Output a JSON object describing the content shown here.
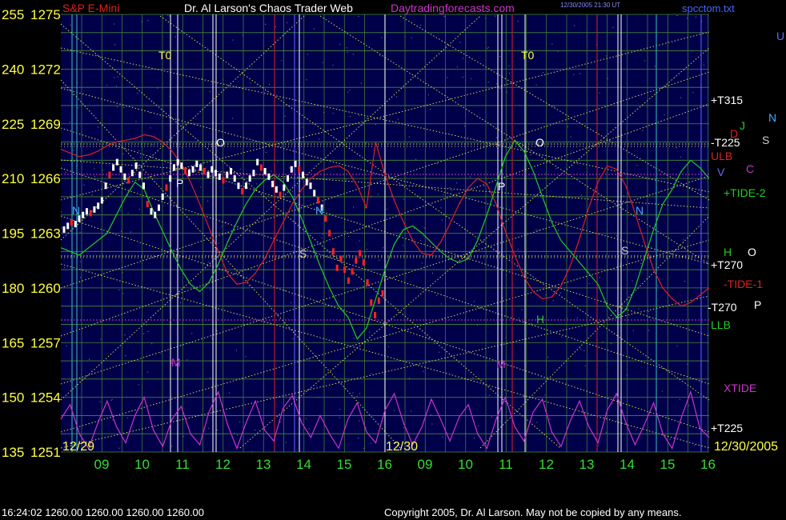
{
  "header": {
    "instrument": "S&P E-Mini",
    "author": "Dr. Al Larson's Chaos Trader Web",
    "site": "Daytradingforecasts.com",
    "stamp_line1": "12/30/2005 21:30 UT",
    "file": "spcctom.txt"
  },
  "footer": {
    "status": "16:24:02  1260.00  1260.00  1260.00  1260.00",
    "copyright": "Copyright 2005, Dr. Al Larson. May not be copied by any means."
  },
  "colors": {
    "background": "#00004a",
    "grid": "#4a8a38",
    "price": "#ffffff",
    "price_alt": "#ff2020",
    "tide": "#22cc22",
    "ulb": "#dd2020",
    "xtide": "#cc33cc",
    "fan": "#e8e850",
    "axis_text": "#ffff44",
    "time_text": "#33dd33"
  },
  "chart_data": {
    "type": "line",
    "title": "",
    "y_left_outer": {
      "ticks": [
        255,
        240,
        225,
        210,
        195,
        180,
        165,
        150,
        135
      ]
    },
    "y_left_inner": {
      "ticks": [
        1275,
        1272,
        1269,
        1266,
        1263,
        1260,
        1257,
        1254,
        1251
      ],
      "ylim": [
        1251,
        1275
      ]
    },
    "x_ticks": [
      "09",
      "10",
      "11",
      "12",
      "13",
      "14",
      "15",
      "16",
      "09",
      "10",
      "11",
      "12",
      "13",
      "14",
      "15",
      "16"
    ],
    "date_labels": [
      "12/29",
      "12/30",
      "12/30/2005"
    ],
    "right_labels": [
      {
        "text": "+T315",
        "color": "#ffffff"
      },
      {
        "text": "J",
        "color": "#22cc22"
      },
      {
        "text": "N",
        "color": "#44aaff"
      },
      {
        "text": "D",
        "color": "#dd2020"
      },
      {
        "text": "-T225",
        "color": "#ffffff"
      },
      {
        "text": "S",
        "color": "#cccccc"
      },
      {
        "text": "ULB",
        "color": "#dd2020"
      },
      {
        "text": "V",
        "color": "#6666ff"
      },
      {
        "text": "C",
        "color": "#cc33cc"
      },
      {
        "text": "+TIDE-2",
        "color": "#22cc22"
      },
      {
        "text": "H",
        "color": "#22cc22"
      },
      {
        "text": "O",
        "color": "#ffffff"
      },
      {
        "text": "+T270",
        "color": "#ffffff"
      },
      {
        "text": "-TIDE-1",
        "color": "#dd2020"
      },
      {
        "text": "-T270",
        "color": "#ffffff"
      },
      {
        "text": "P",
        "color": "#ffffff"
      },
      {
        "text": "LLB",
        "color": "#22cc22"
      },
      {
        "text": "XTIDE",
        "color": "#cc33cc"
      },
      {
        "text": "+T225",
        "color": "#ffffff"
      },
      {
        "text": "U",
        "color": "#6666ff"
      }
    ],
    "markers": [
      "T0",
      "T0",
      "O",
      "O",
      "P",
      "P",
      "N",
      "N",
      "N",
      "S",
      "S",
      "M",
      "M",
      "H"
    ],
    "price_1m": [
      1263.2,
      1263.4,
      1263.6,
      1263.5,
      1263.8,
      1264.0,
      1264.2,
      1264.1,
      1264.3,
      1264.5,
      1264.8,
      1265.6,
      1266.2,
      1266.6,
      1266.9,
      1266.5,
      1266.1,
      1265.9,
      1266.3,
      1266.7,
      1266.2,
      1265.6,
      1264.6,
      1264.2,
      1264.0,
      1264.4,
      1265.0,
      1265.5,
      1266.0,
      1266.6,
      1266.9,
      1266.7,
      1266.4,
      1266.3,
      1266.5,
      1266.8,
      1266.6,
      1266.4,
      1266.2,
      1266.5,
      1266.3,
      1266.1,
      1265.9,
      1266.2,
      1266.4,
      1266.0,
      1265.6,
      1265.3,
      1265.6,
      1266.0,
      1266.3,
      1266.9,
      1266.6,
      1266.4,
      1266.1,
      1265.7,
      1265.4,
      1265.1,
      1265.5,
      1266.0,
      1266.5,
      1266.8,
      1266.5,
      1266.2,
      1265.8,
      1265.6,
      1265.2,
      1264.8,
      1264.4,
      1263.8,
      1263.0,
      1262.0,
      1261.1,
      1261.6,
      1261.0,
      1260.4,
      1260.9,
      1261.5,
      1261.9,
      1261.4,
      1260.3,
      1259.2,
      1258.5,
      1259.3,
      1259.7
    ],
    "tide": [
      1262.2,
      1262.0,
      1261.8,
      1262.2,
      1262.6,
      1263.0,
      1264.0,
      1265.0,
      1265.8,
      1265.4,
      1264.2,
      1263.1,
      1262.0,
      1261.0,
      1260.2,
      1259.8,
      1260.3,
      1261.3,
      1262.5,
      1263.6,
      1264.6,
      1265.4,
      1265.9,
      1266.2,
      1265.8,
      1265.0,
      1263.8,
      1262.5,
      1261.2,
      1260.0,
      1259.0,
      1258.4,
      1257.2,
      1257.8,
      1259.4,
      1261.0,
      1262.4,
      1263.2,
      1263.4,
      1263.0,
      1262.5,
      1262.0,
      1261.6,
      1261.4,
      1261.6,
      1262.6,
      1264.0,
      1265.6,
      1267.2,
      1268.1,
      1267.5,
      1266.4,
      1265.0,
      1263.6,
      1262.6,
      1262.0,
      1261.4,
      1260.8,
      1260.2,
      1259.0,
      1258.4,
      1258.8,
      1260.0,
      1261.6,
      1263.2,
      1264.6,
      1265.4,
      1266.4,
      1267.0,
      1266.6,
      1266.0
    ],
    "ulb": [
      1267.6,
      1267.4,
      1267.2,
      1267.3,
      1267.5,
      1267.8,
      1268.0,
      1268.1,
      1268.2,
      1268.4,
      1268.3,
      1268.0,
      1267.5,
      1266.8,
      1265.8,
      1264.6,
      1263.3,
      1262.0,
      1260.8,
      1260.2,
      1260.3,
      1260.8,
      1261.6,
      1262.6,
      1263.6,
      1264.6,
      1265.4,
      1266.0,
      1266.4,
      1266.6,
      1266.7,
      1266.4,
      1265.6,
      1264.4,
      1268.0,
      1266.2,
      1264.8,
      1263.6,
      1262.6,
      1261.9,
      1261.8,
      1262.5,
      1263.5,
      1264.6,
      1265.5,
      1266.0,
      1265.7,
      1264.6,
      1263.1,
      1261.8,
      1260.6,
      1259.8,
      1259.4,
      1259.5,
      1260.1,
      1261.2,
      1262.7,
      1264.4,
      1265.8,
      1266.7,
      1266.5,
      1265.6,
      1264.1,
      1262.5,
      1261.0,
      1260.0,
      1259.4,
      1259.0,
      1259.2,
      1259.6,
      1260.0
    ],
    "xtide": [
      1252.8,
      1253.6,
      1252.0,
      1251.2,
      1252.6,
      1253.8,
      1252.4,
      1251.5,
      1253.0,
      1254.0,
      1252.2,
      1251.3,
      1252.8,
      1253.5,
      1252.0,
      1251.4,
      1253.2,
      1254.3,
      1252.5,
      1251.2,
      1252.6,
      1253.8,
      1252.2,
      1251.6,
      1253.4,
      1254.1,
      1252.6,
      1251.8,
      1253.0,
      1252.0,
      1251.2,
      1252.8,
      1253.7,
      1252.1,
      1251.5,
      1253.3,
      1254.2,
      1252.6,
      1251.4,
      1252.4,
      1253.9,
      1252.8,
      1251.6,
      1252.9,
      1253.6,
      1252.0,
      1251.2,
      1252.8,
      1254.0,
      1252.4,
      1251.6,
      1253.2,
      1253.9,
      1252.1,
      1251.3,
      1252.7,
      1253.8,
      1252.4,
      1251.5,
      1253.3,
      1254.2,
      1252.6,
      1251.4,
      1252.5,
      1253.7,
      1252.0,
      1251.2,
      1252.9,
      1254.3,
      1252.3,
      1251.8
    ]
  }
}
